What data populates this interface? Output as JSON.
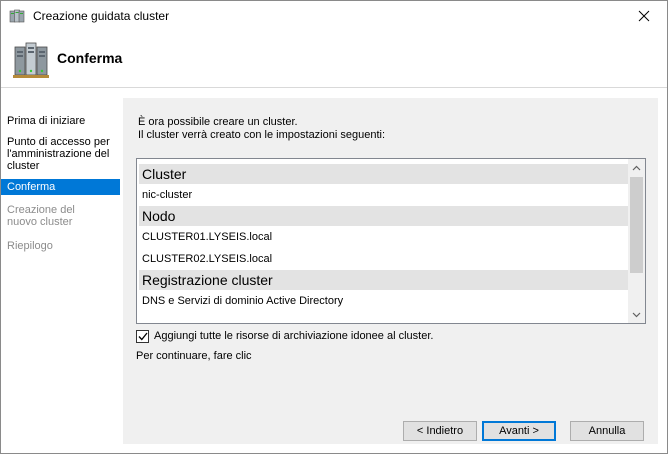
{
  "window": {
    "title": "Creazione guidata cluster",
    "close_glyph": "✕"
  },
  "header": {
    "heading": "Conferma",
    "icon": "cluster-servers-icon"
  },
  "nav": {
    "items": [
      {
        "label": "Prima di iniziare",
        "state": "normal"
      },
      {
        "label": "Punto di accesso per l'amministrazione del cluster",
        "state": "normal"
      },
      {
        "label": "Conferma",
        "state": "active"
      },
      {
        "label": "Creazione del nuovo cluster",
        "state": "disabled"
      },
      {
        "label": "Riepilogo",
        "state": "disabled"
      }
    ]
  },
  "content": {
    "intro_line1": "È ora possibile creare un cluster.",
    "intro_line2": "Il cluster verrà creato con le impostazioni seguenti:",
    "list": {
      "rows": [
        {
          "type": "section",
          "text": "Cluster"
        },
        {
          "type": "item",
          "text": "nic-cluster"
        },
        {
          "type": "section",
          "text": "Nodo"
        },
        {
          "type": "item",
          "text": "CLUSTER01.LYSEIS.local"
        },
        {
          "type": "item",
          "text": "CLUSTER02.LYSEIS.local"
        },
        {
          "type": "section",
          "text": "Registrazione cluster"
        },
        {
          "type": "item",
          "text": "DNS e Servizi di dominio Active Directory"
        }
      ]
    },
    "checkbox_label": "Aggiungi tutte le risorse di archiviazione idonee al cluster.",
    "checkbox_checked": true,
    "continue_text": "Per continuare, fare clic"
  },
  "buttons": {
    "back": "< Indietro",
    "next": "Avanti >",
    "cancel": "Annulla"
  },
  "colors": {
    "accent": "#0078d7",
    "panel_bg": "#f0f0f0",
    "section_bg": "#e3e3e3"
  }
}
